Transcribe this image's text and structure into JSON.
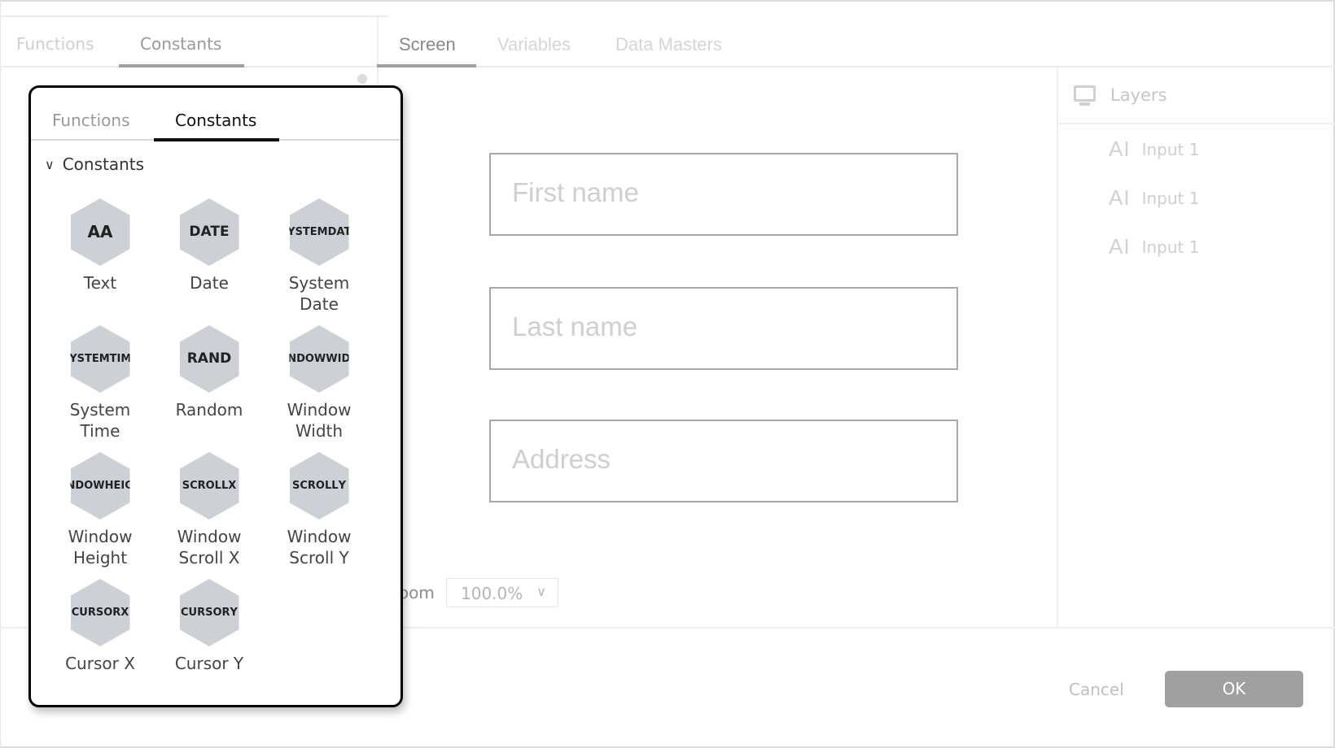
{
  "left_tabs": [
    {
      "label": "Functions"
    },
    {
      "label": "Constants",
      "active": true
    }
  ],
  "main_tabs": [
    {
      "label": "Screen",
      "active": true
    },
    {
      "label": "Variables"
    },
    {
      "label": "Data Masters"
    }
  ],
  "inputs": [
    {
      "placeholder": "First name"
    },
    {
      "placeholder": "Last name"
    },
    {
      "placeholder": "Address"
    }
  ],
  "zoom": {
    "label": "Zoom",
    "label_visible": "oom",
    "value": "100.0%"
  },
  "layers": {
    "title": "Layers",
    "icon": "monitor-icon",
    "items": [
      {
        "icon": "AI",
        "label": "Input 1"
      },
      {
        "icon": "AI",
        "label": "Input 1"
      },
      {
        "icon": "AI",
        "label": "Input 1"
      }
    ]
  },
  "footer": {
    "cancel": "Cancel",
    "ok": "OK"
  },
  "popup": {
    "tabs": [
      {
        "label": "Functions"
      },
      {
        "label": "Constants",
        "active": true
      }
    ],
    "section": "Constants",
    "items": [
      {
        "badge": [
          "AA"
        ],
        "label": [
          "Text"
        ]
      },
      {
        "badge": [
          "DATE"
        ],
        "label": [
          "Date"
        ]
      },
      {
        "badge": [
          "SYSTEM",
          "DATE"
        ],
        "label": [
          "System",
          "Date"
        ]
      },
      {
        "badge": [
          "SYSTEM",
          "TIME"
        ],
        "label": [
          "System",
          "Time"
        ]
      },
      {
        "badge": [
          "RAND"
        ],
        "label": [
          "Random"
        ]
      },
      {
        "badge": [
          "WINDOW",
          "WIDTH"
        ],
        "label": [
          "Window",
          "Width"
        ]
      },
      {
        "badge": [
          "WINDOW",
          "HEIGHT"
        ],
        "label": [
          "Window",
          "Height"
        ]
      },
      {
        "badge": [
          "SCROLL",
          "X"
        ],
        "label": [
          "Window",
          "Scroll X"
        ]
      },
      {
        "badge": [
          "SCROLL",
          "Y"
        ],
        "label": [
          "Window",
          "Scroll Y"
        ]
      },
      {
        "badge": [
          "CURSOR",
          "X"
        ],
        "label": [
          "Cursor X"
        ]
      },
      {
        "badge": [
          "CURSOR",
          "Y"
        ],
        "label": [
          "Cursor Y"
        ]
      }
    ]
  },
  "colors": {
    "ok_button": "#a0a0a0",
    "hex_badge": "#cdd1d5",
    "popup_border": "#000000"
  }
}
